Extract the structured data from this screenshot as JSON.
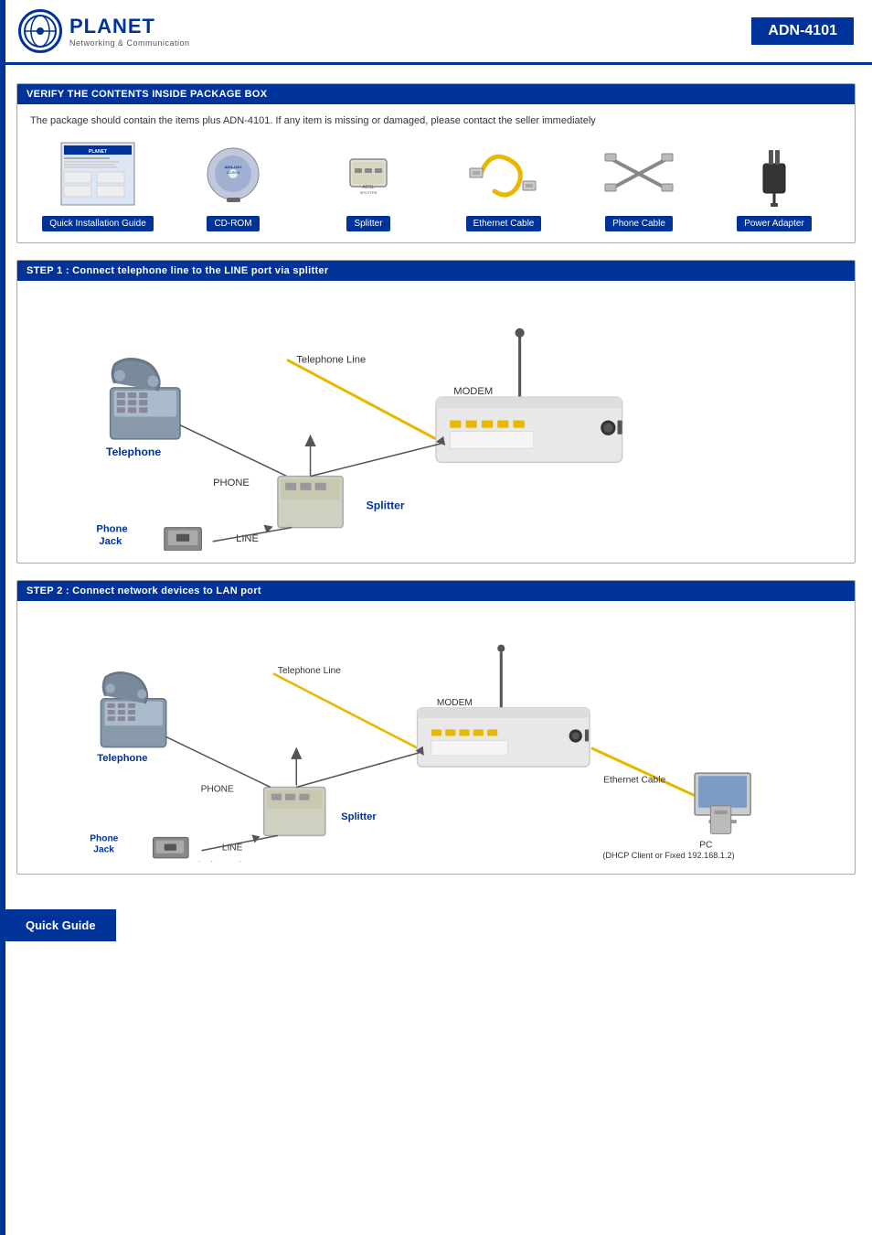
{
  "header": {
    "model": "ADN-4101",
    "logo_main": "PLANET",
    "logo_sub": "Networking & Communication"
  },
  "section1": {
    "title": "VERIFY THE CONTENTS INSIDE PACKAGE BOX",
    "description": "The package should contain the items plus ADN-4101. If any item is missing or damaged, please contact the seller immediately",
    "items": [
      {
        "label": "Quick Installation Guide",
        "type": "guide"
      },
      {
        "label": "CD-ROM",
        "type": "cd"
      },
      {
        "label": "Splitter",
        "type": "splitter"
      },
      {
        "label": "Ethernet Cable",
        "type": "ethernet"
      },
      {
        "label": "Phone Cable",
        "type": "phone"
      },
      {
        "label": "Power Adapter",
        "type": "power"
      }
    ]
  },
  "section2": {
    "title": "STEP 1 : Connect telephone line to the LINE port via splitter",
    "labels": {
      "telephone_line1": "Telephone Line",
      "telephone": "Telephone",
      "modem": "MODEM",
      "phone": "PHONE",
      "splitter": "Splitter",
      "line": "LINE",
      "phone_jack": "Phone\nJack",
      "telephone_line2": "Telephone Line"
    }
  },
  "section3": {
    "title": "STEP 2 : Connect network devices to LAN port",
    "labels": {
      "telephone_line1": "Telephone Line",
      "telephone": "Telephone",
      "modem": "MODEM",
      "phone": "PHONE",
      "splitter": "Splitter",
      "line": "LINE",
      "phone_jack": "Phone\nJack",
      "telephone_line2": "Telephone Line",
      "ethernet_cable": "Ethernet Cable",
      "pc": "PC",
      "pc_sub": "(DHCP Client or Fixed 192.168.1.2)"
    }
  },
  "footer": {
    "label": "Quick Guide"
  }
}
